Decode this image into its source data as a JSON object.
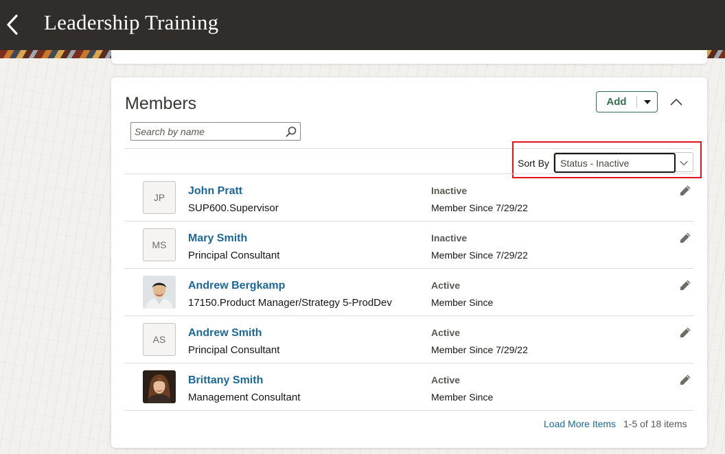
{
  "header": {
    "title": "Leadership Training",
    "back_icon": "chevron-left-icon"
  },
  "colors": {
    "header_bg": "#312d2a",
    "link": "#1b6797",
    "add_button": "#2f6e4e",
    "highlight": "#e0121b"
  },
  "members": {
    "title": "Members",
    "add_label": "Add",
    "search": {
      "placeholder": "Search by name",
      "value": ""
    },
    "sort": {
      "label": "Sort By",
      "value": "Status - Inactive"
    },
    "items": [
      {
        "initials": "JP",
        "name": "John Pratt",
        "subtitle": "SUP600.Supervisor",
        "status": "Inactive",
        "since": "Member Since 7/29/22",
        "photo": false
      },
      {
        "initials": "MS",
        "name": "Mary Smith",
        "subtitle": "Principal Consultant",
        "status": "Inactive",
        "since": "Member Since 7/29/22",
        "photo": false
      },
      {
        "initials": "",
        "name": "Andrew Bergkamp",
        "subtitle": "17150.Product Manager/Strategy 5-ProdDev",
        "status": "Active",
        "since": "Member Since",
        "photo": true
      },
      {
        "initials": "AS",
        "name": "Andrew Smith",
        "subtitle": "Principal Consultant",
        "status": "Active",
        "since": "Member Since 7/29/22",
        "photo": false
      },
      {
        "initials": "",
        "name": "Brittany Smith",
        "subtitle": "Management Consultant",
        "status": "Active",
        "since": "Member Since",
        "photo": true
      }
    ],
    "load_more": "Load More Items",
    "count": "1-5 of 18 items"
  }
}
